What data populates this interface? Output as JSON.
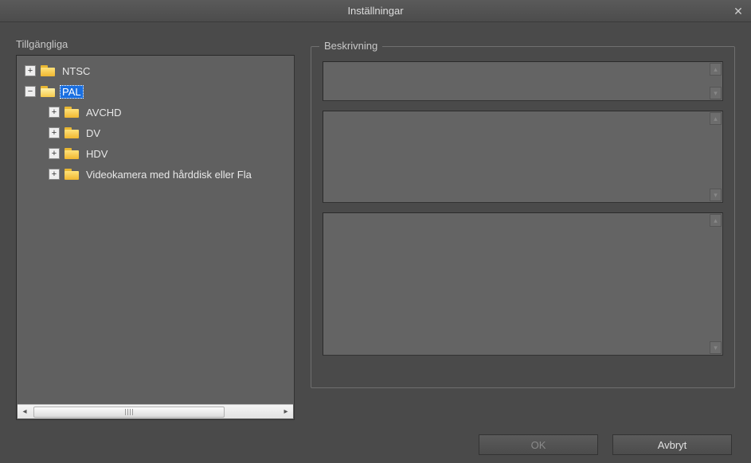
{
  "window": {
    "title": "Inställningar",
    "close_glyph": "✕"
  },
  "left": {
    "heading": "Tillgängliga",
    "tree": {
      "ntsc": {
        "label": "NTSC",
        "expander": "+"
      },
      "pal": {
        "label": "PAL",
        "expander": "−",
        "selected": true
      },
      "children": {
        "avchd": {
          "label": "AVCHD",
          "expander": "+"
        },
        "dv": {
          "label": "DV",
          "expander": "+"
        },
        "hdv": {
          "label": "HDV",
          "expander": "+"
        },
        "cam": {
          "label": "Videokamera med hårddisk eller Fla",
          "expander": "+"
        }
      }
    },
    "hscroll": {
      "left_glyph": "◂",
      "right_glyph": "▸"
    }
  },
  "right": {
    "legend": "Beskrivning",
    "boxes": {
      "a": "",
      "b": "",
      "c": ""
    },
    "pager": {
      "up_glyph": "▴",
      "down_glyph": "▾"
    }
  },
  "buttons": {
    "ok": "OK",
    "cancel": "Avbryt"
  }
}
